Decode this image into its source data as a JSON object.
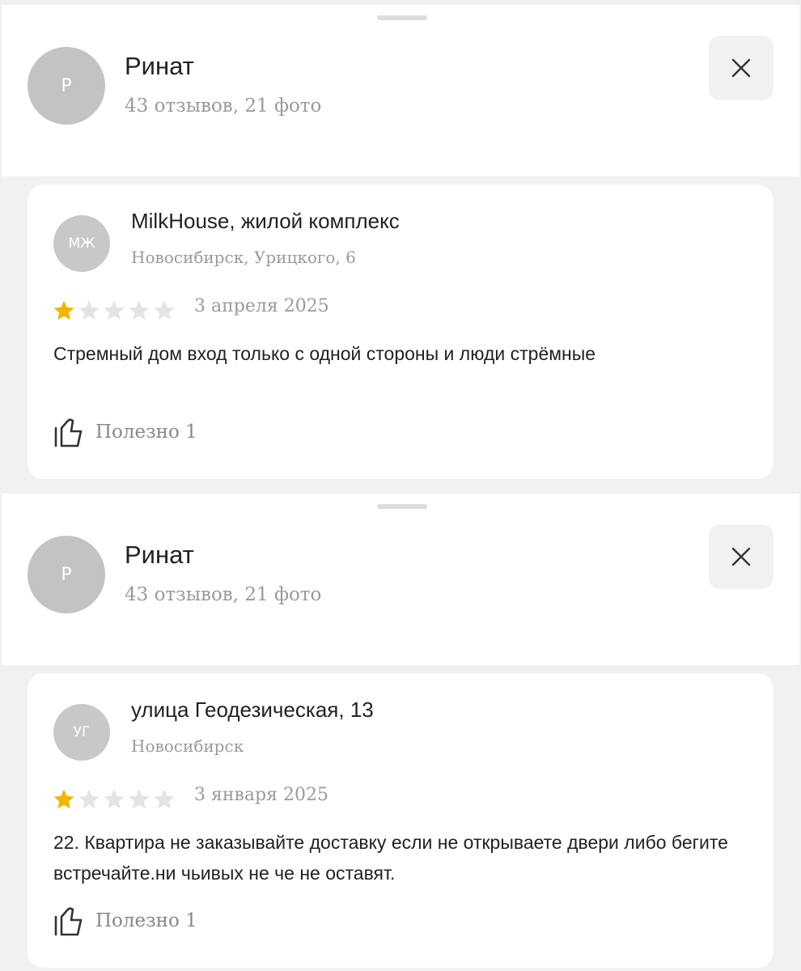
{
  "colors": {
    "star_filled": "#f4b400",
    "star_empty": "#e4e4e4",
    "avatar": "#c3c3c3",
    "muted_text": "#9a9a9a"
  },
  "icons": [
    "close-icon",
    "star-icon",
    "thumbs-up-icon"
  ],
  "panels": [
    {
      "user": {
        "avatar_initial": "Р",
        "name": "Ринат",
        "stats": "43 отзывов, 21 фото"
      },
      "review": {
        "avatar_initials": "МЖ",
        "place_name": "MilkHouse, жилой комплекс",
        "place_address": "Новосибирск, Урицкого, 6",
        "rating": 1,
        "rating_max": 5,
        "date": "3 апреля 2025",
        "text": "Стремный дом вход только с одной стороны и люди стрёмные",
        "useful_label": "Полезно 1"
      }
    },
    {
      "user": {
        "avatar_initial": "Р",
        "name": "Ринат",
        "stats": "43 отзывов, 21 фото"
      },
      "review": {
        "avatar_initials": "УГ",
        "place_name": "улица Геодезическая, 13",
        "place_address": "Новосибирск",
        "rating": 1,
        "rating_max": 5,
        "date": "3 января 2025",
        "text": "22. Квартира не заказывайте доставку если не открываете двери либо бегите встречайте.ни чьивых не че не оставят.",
        "useful_label": "Полезно 1"
      }
    }
  ]
}
